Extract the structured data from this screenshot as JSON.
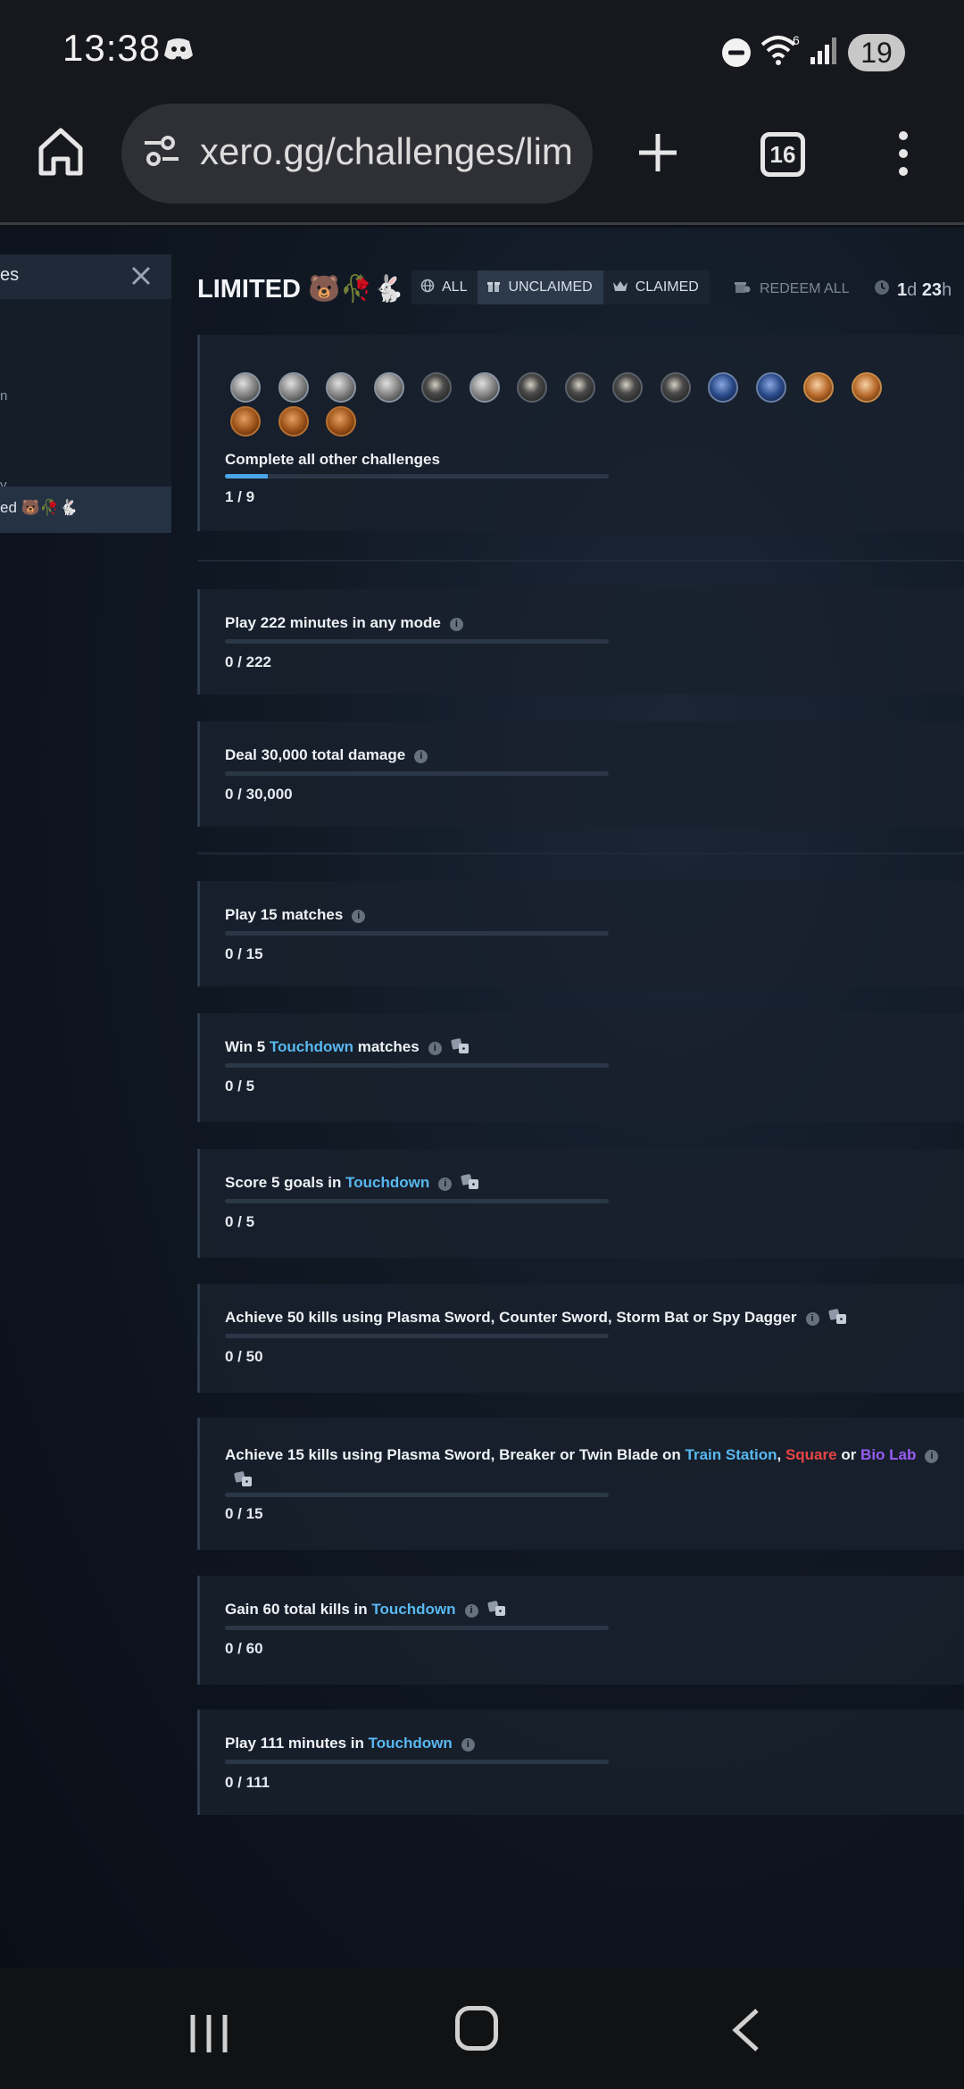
{
  "status": {
    "time": "13:38",
    "battery": "19",
    "icons": [
      "discord-icon",
      "dnd-icon",
      "wifi-icon",
      "signal-icon"
    ]
  },
  "browser": {
    "url": "xero.gg/challenges/lim",
    "tab_count": "16",
    "icons": [
      "home-icon",
      "site-settings-icon",
      "new-tab-icon",
      "more-vert-icon"
    ]
  },
  "sidebar": {
    "search_text": "es",
    "items": [
      "n",
      "y"
    ],
    "active_item": "ed 🐻🥀🐇"
  },
  "header": {
    "title": "LIMITED 🐻🥀🐇",
    "filters": [
      {
        "label": "ALL",
        "icon": "globe-icon",
        "active": false
      },
      {
        "label": "UNCLAIMED",
        "icon": "gift-icon",
        "active": true
      },
      {
        "label": "CLAIMED",
        "icon": "crown-icon",
        "active": false
      }
    ],
    "redeem_label": "REDEEM ALL",
    "timer_days": "1",
    "timer_days_unit": "d",
    "timer_hours": "23",
    "timer_hours_unit": "h"
  },
  "master_challenge": {
    "title": "Complete all other challenges",
    "progress": "1 / 9",
    "fraction": 0.111,
    "badges": [
      "silver",
      "silver",
      "silver",
      "silver",
      "dark",
      "silver",
      "dark",
      "dark",
      "dark",
      "dark",
      "blue",
      "blue",
      "gold",
      "gold",
      "bronze",
      "bronze",
      "bronze"
    ]
  },
  "challenges": [
    {
      "parts": [
        {
          "t": "Play 222 minutes in any mode",
          "c": ""
        }
      ],
      "dice": false,
      "progress": "0 / 222"
    },
    {
      "parts": [
        {
          "t": "Deal 30,000 total damage",
          "c": ""
        }
      ],
      "dice": false,
      "progress": "0 / 30,000"
    },
    {
      "parts": [
        {
          "t": "Play 15 matches",
          "c": ""
        }
      ],
      "dice": false,
      "progress": "0 / 15"
    },
    {
      "parts": [
        {
          "t": "Win 5 ",
          "c": ""
        },
        {
          "t": "Touchdown",
          "c": "blue"
        },
        {
          "t": " matches",
          "c": ""
        }
      ],
      "dice": true,
      "progress": "0 / 5"
    },
    {
      "parts": [
        {
          "t": "Score 5 goals in ",
          "c": ""
        },
        {
          "t": "Touchdown",
          "c": "blue"
        }
      ],
      "dice": true,
      "progress": "0 / 5"
    },
    {
      "parts": [
        {
          "t": "Achieve 50 kills using Plasma Sword, Counter Sword, Storm Bat or Spy Dagger",
          "c": ""
        }
      ],
      "dice": true,
      "progress": "0 / 50"
    },
    {
      "parts": [
        {
          "t": "Achieve 15 kills using Plasma Sword, Breaker or Twin Blade on ",
          "c": ""
        },
        {
          "t": "Train Station",
          "c": "blue"
        },
        {
          "t": ", ",
          "c": ""
        },
        {
          "t": "Square",
          "c": "red"
        },
        {
          "t": " or ",
          "c": ""
        },
        {
          "t": "Bio Lab",
          "c": "purple"
        }
      ],
      "dice": true,
      "progress": "0 / 15"
    },
    {
      "parts": [
        {
          "t": "Gain 60 total kills in ",
          "c": ""
        },
        {
          "t": "Touchdown",
          "c": "blue"
        }
      ],
      "dice": true,
      "progress": "0 / 60"
    },
    {
      "parts": [
        {
          "t": "Play 111 minutes in ",
          "c": ""
        },
        {
          "t": "Touchdown",
          "c": "blue"
        }
      ],
      "dice": false,
      "progress": "0 / 111"
    }
  ],
  "colors": {
    "accent_blue": "#59b8f0",
    "accent_red": "#e84545",
    "accent_purple": "#9a5cf5",
    "progress_fill": "#4aa6e8"
  },
  "nav": {
    "icons": [
      "recents-icon",
      "home-circle-icon",
      "back-icon"
    ]
  }
}
